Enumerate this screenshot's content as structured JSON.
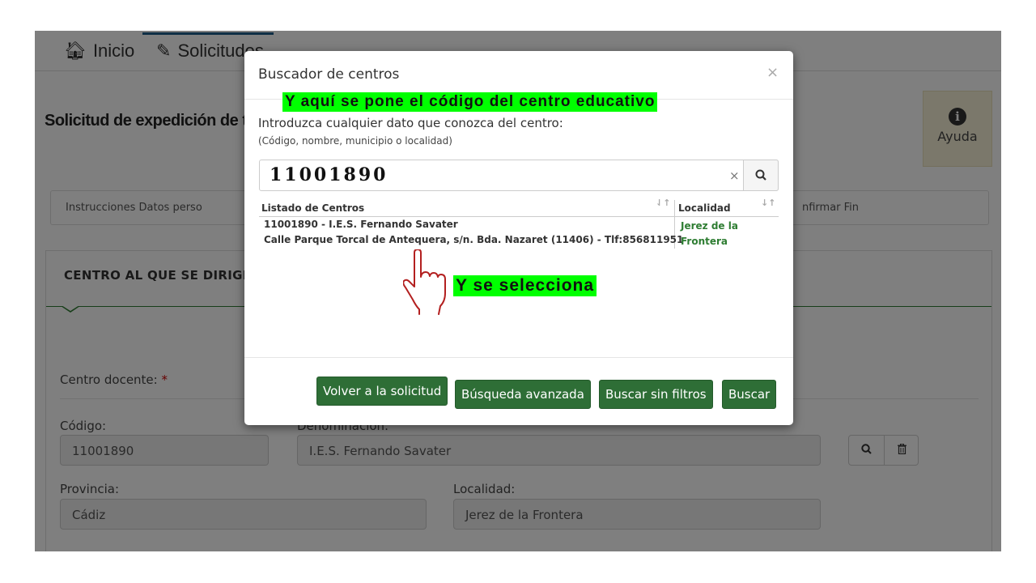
{
  "nav": {
    "tabs": [
      {
        "icon": "home-icon",
        "label": "Inicio"
      },
      {
        "icon": "pencil-icon",
        "label": "Solicitudes"
      }
    ]
  },
  "page": {
    "title": "Solicitud de expedición de títulos"
  },
  "help": {
    "label": "Ayuda"
  },
  "steps": {
    "left": "Instrucciones  Datos perso",
    "right": "nfirmar  Fin"
  },
  "panel": {
    "title": "CENTRO AL QUE SE DIRIGE"
  },
  "form": {
    "centro_label": "Centro docente: ",
    "required_mark": "*",
    "codigo_label": "Código:",
    "codigo_value": "11001890",
    "denominacion_label": "Denominación:",
    "denominacion_value": "I.E.S. Fernando Savater",
    "provincia_label": "Provincia:",
    "provincia_value": "Cádiz",
    "localidad_label": "Localidad:",
    "localidad_value": "Jerez de la Frontera"
  },
  "modal": {
    "title": "Buscador de centros",
    "close": "×",
    "annotation_top": "Y aquí se pone el código del centro educativo",
    "intro": "Introduzca cualquier dato que conozca del centro:",
    "hint": "(Código, nombre, municipio o localidad)",
    "search_value": "11001890",
    "search_clear": "×",
    "grid": {
      "col1": "Listado de Centros",
      "col2": "Localidad",
      "row": {
        "line1": "11001890 - I.E.S. Fernando Savater",
        "line2": "Calle Parque Torcal de Antequera, s/n. Bda. Nazaret (11406) - Tlf:856811951",
        "localidad": "Jerez de la Frontera"
      }
    },
    "annotation_select": "Y se selecciona",
    "buttons": {
      "back": "Volver a la solicitud",
      "advanced": "Búsqueda avanzada",
      "nofilter": "Buscar sin filtros",
      "search": "Buscar"
    }
  },
  "colors": {
    "accent_green": "#2e6e36",
    "highlight": "#00ff00",
    "location_text": "#2e7d32"
  }
}
